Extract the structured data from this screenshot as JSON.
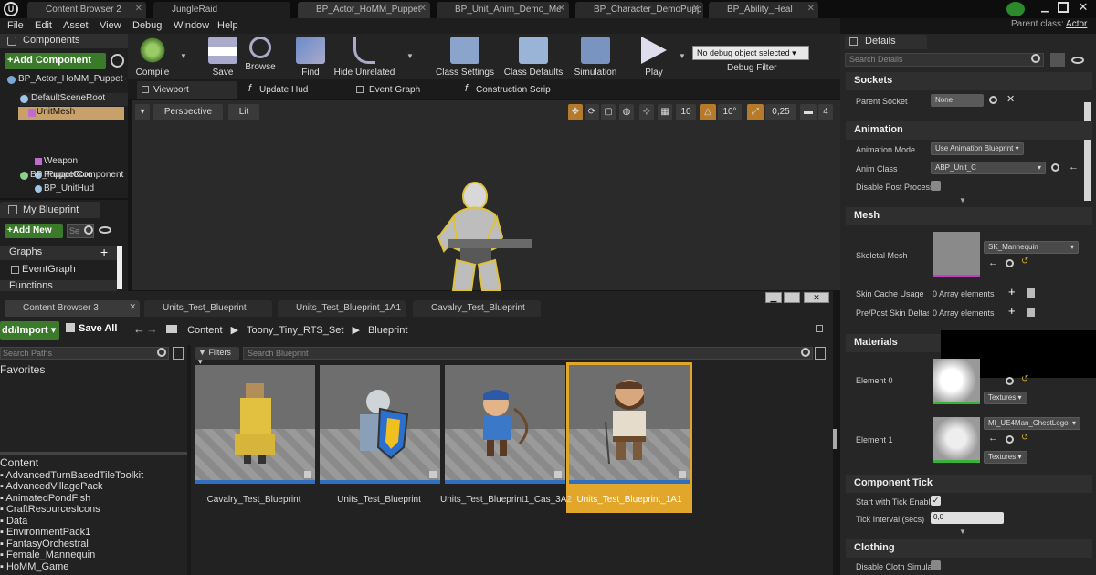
{
  "window": {
    "tabs": [
      "Content Browser 2",
      "JungleRaid",
      "BP_Actor_HoMM_Puppet",
      "BP_Unit_Anim_Demo_Me",
      "BP_Character_DemoPupp",
      "BP_Ability_Heal"
    ],
    "parent_class_label": "Parent class:",
    "parent_class_value": "Actor"
  },
  "menu": [
    "File",
    "Edit",
    "Asset",
    "View",
    "Debug",
    "Window",
    "Help"
  ],
  "components": {
    "title": "Components",
    "add_button": "+Add Component",
    "root_label": "BP_Actor_HoMM_Puppet (",
    "tree": [
      "DefaultSceneRoot",
      "UnitMesh",
      "Weapon",
      "PuppetCore",
      "BP_UnitHud",
      "BP_PuppetComponent"
    ]
  },
  "my_blueprint": {
    "title": "My Blueprint",
    "add_new": "+Add New",
    "search_placeholder": "Se",
    "graphs_label": "Graphs",
    "event_graph": "EventGraph",
    "functions_label": "Functions"
  },
  "toolbar": [
    "Compile",
    "Save",
    "Browse",
    "Find",
    "Hide Unrelated",
    "Class Settings",
    "Class Defaults",
    "Simulation",
    "Play"
  ],
  "debug": {
    "select": "No debug object selected",
    "label": "Debug Filter"
  },
  "editor_tabs": [
    "Viewport",
    "Update Hud",
    "Event Graph",
    "Construction Scrip"
  ],
  "viewport": {
    "perspective": "Perspective",
    "lit": "Lit",
    "grid_snap": "10",
    "rot_snap": "10°",
    "scale_snap": "0,25",
    "cam_speed": "4"
  },
  "content_browser": {
    "tabs": [
      "Content Browser 3",
      "Units_Test_Blueprint",
      "Units_Test_Blueprint_1A1",
      "Cavalry_Test_Blueprint"
    ],
    "add_import": "dd/Import",
    "save_all": "Save All",
    "breadcrumb": [
      "Content",
      "Toony_Tiny_RTS_Set",
      "Blueprint"
    ],
    "search_paths": "Search Paths",
    "filters": "Filters",
    "search_blueprint": "Search Blueprint",
    "favorites": "Favorites",
    "content_label": "Content",
    "folders": [
      "AdvancedTurnBasedTileToolkit",
      "AdvancedVillagePack",
      "AnimatedPondFish",
      "CraftResourcesIcons",
      "Data",
      "EnvironmentPack1",
      "FantasyOrchestral",
      "Female_Mannequin",
      "HoMM_Game"
    ],
    "assets": [
      "Cavalry_Test_Blueprint",
      "Units_Test_Blueprint",
      "Units_Test_Blueprint1_Cas_3A2",
      "Units_Test_Blueprint_1A1"
    ]
  },
  "details": {
    "title": "Details",
    "search_placeholder": "Search Details",
    "sockets": {
      "header": "Sockets",
      "parent_socket_label": "Parent Socket",
      "parent_socket_value": "None"
    },
    "animation": {
      "header": "Animation",
      "mode_label": "Animation Mode",
      "mode_value": "Use Animation Blueprint",
      "class_label": "Anim Class",
      "class_value": "ABP_Unit_C",
      "disable_pp_label": "Disable Post Process"
    },
    "mesh": {
      "header": "Mesh",
      "skeletal_label": "Skeletal Mesh",
      "skeletal_value": "SK_Mannequin",
      "cache_label": "Skin Cache Usage",
      "cache_value": "0 Array elements",
      "deltas_label": "Pre/Post Skin Deltas U",
      "deltas_value": "0 Array elements"
    },
    "materials": {
      "header": "Materials",
      "e0_label": "Element 0",
      "e0_textures": "Textures",
      "e1_label": "Element 1",
      "e1_value": "MI_UE4Man_ChestLogo",
      "e1_textures": "Textures"
    },
    "tick": {
      "header": "Component Tick",
      "start_label": "Start with Tick Enable",
      "interval_label": "Tick Interval (secs)",
      "interval_value": "0,0"
    },
    "clothing": {
      "header": "Clothing",
      "disable_label": "Disable Cloth Simulatio"
    }
  }
}
